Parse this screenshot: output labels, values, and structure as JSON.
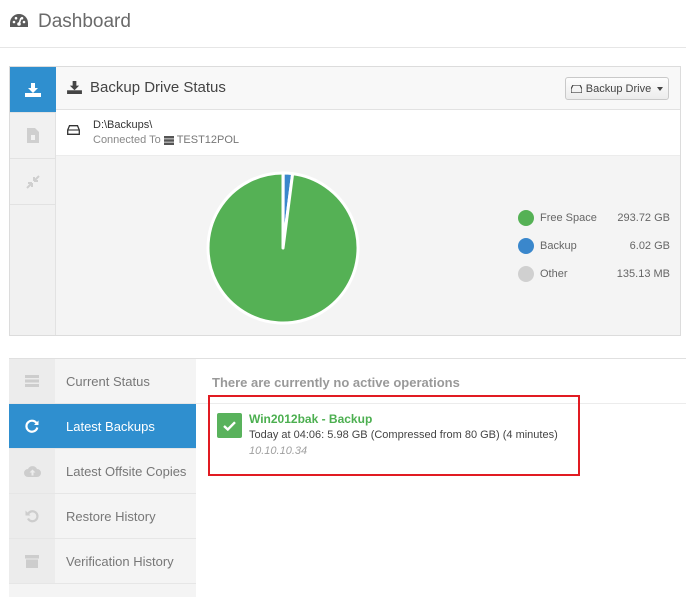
{
  "header": {
    "title": "Dashboard",
    "icon": "dashboard-gauge-icon"
  },
  "drive_panel": {
    "title": "Backup Drive Status",
    "button_label": "Backup Drive",
    "path": "D:\\Backups\\",
    "connected_label": "Connected To",
    "host": "TEST12POL",
    "side_tabs": [
      "download-icon",
      "file-icon",
      "compress-icon"
    ]
  },
  "chart_data": {
    "type": "pie",
    "title": "",
    "unit": "GB",
    "slices": [
      {
        "label": "Free Space",
        "value": 293.72,
        "display": "293.72 GB",
        "color": "#55b155"
      },
      {
        "label": "Backup",
        "value": 6.02,
        "display": "6.02 GB",
        "color": "#3a87cc"
      },
      {
        "label": "Other",
        "value": 0.132,
        "display": "135.13 MB",
        "color": "#d0d0d0"
      }
    ],
    "legend_position": "right"
  },
  "nav": {
    "items": [
      {
        "label": "Current Status",
        "icon": "list-icon",
        "active": false
      },
      {
        "label": "Latest Backups",
        "icon": "refresh-icon",
        "active": true
      },
      {
        "label": "Latest Offsite Copies",
        "icon": "cloud-upload-icon",
        "active": false
      },
      {
        "label": "Restore History",
        "icon": "undo-icon",
        "active": false
      },
      {
        "label": "Verification History",
        "icon": "archive-icon",
        "active": false
      }
    ]
  },
  "content": {
    "no_ops": "There are currently no active operations",
    "backup": {
      "name": "Win2012bak - Backup",
      "detail": "Today at 04:06: 5.98 GB (Compressed from 80 GB) (4 minutes)",
      "ip": "10.10.10.34"
    }
  },
  "colors": {
    "accent": "#2f8fcf",
    "success": "#59b25c",
    "highlight": "#e11b22"
  }
}
